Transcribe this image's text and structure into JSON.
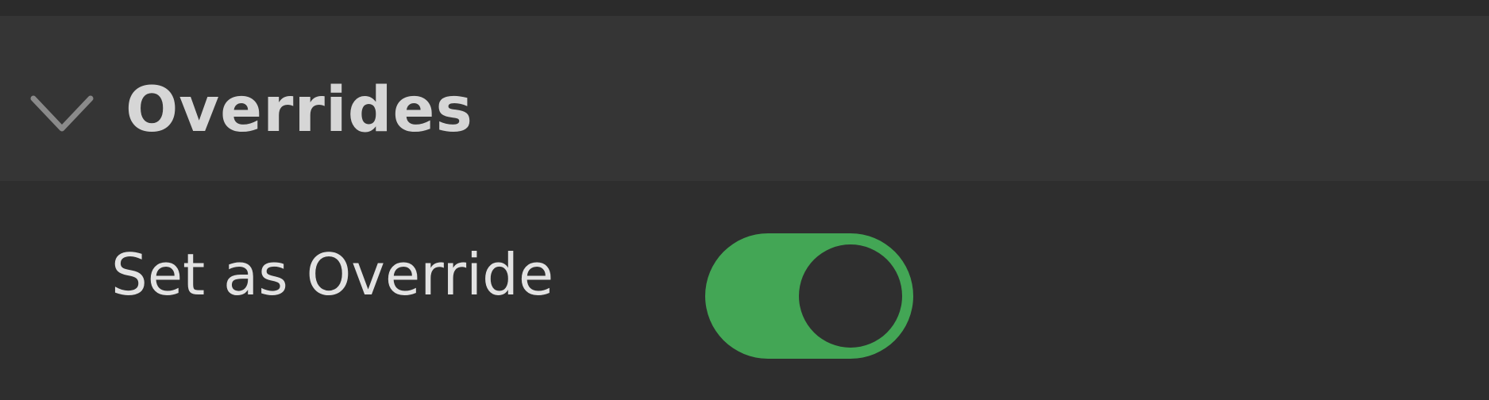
{
  "section": {
    "title": "Overrides",
    "expanded": true,
    "chevron_icon": "chevron-down-icon"
  },
  "rows": {
    "set_as_override": {
      "label": "Set as Override",
      "toggle_on": true,
      "toggle_color": "#43a655"
    }
  },
  "colors": {
    "background": "#2e2e2e",
    "header_background": "#353535",
    "header_text": "#d6d6d6",
    "label_text": "#e2e2e2",
    "accent_on": "#43a655"
  }
}
